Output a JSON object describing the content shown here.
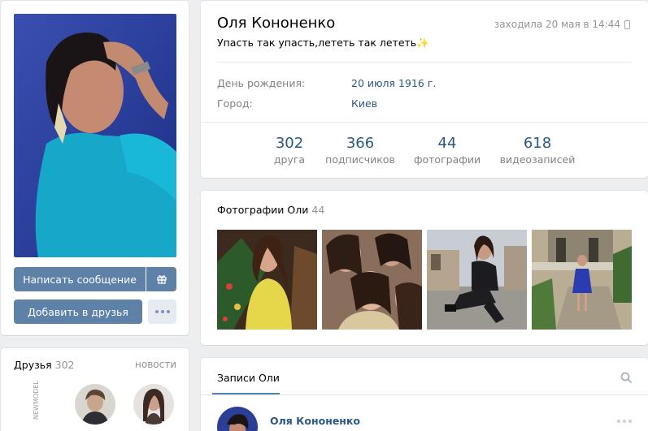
{
  "profile": {
    "name": "Оля Кононенко",
    "last_seen": "заходила 20 мая в 14:44",
    "status": "Упасть так упасть,лететь так лететь✨",
    "info": [
      {
        "label": "День рождения:",
        "value": "20 июля 1916 г."
      },
      {
        "label": "Город:",
        "value": "Киев"
      }
    ],
    "counters": [
      {
        "num": "302",
        "label": "друга"
      },
      {
        "num": "366",
        "label": "подписчиков"
      },
      {
        "num": "44",
        "label": "фотографии"
      },
      {
        "num": "618",
        "label": "видеозаписей"
      }
    ]
  },
  "actions": {
    "message": "Написать сообщение",
    "add_friend": "Добавить в друзья"
  },
  "friends": {
    "title": "Друзья",
    "count": "302",
    "news": "новости",
    "watermark": "NEWMODEL"
  },
  "photos": {
    "title": "Фотографии Оли",
    "count": "44"
  },
  "wall": {
    "tab": "Записи Оли",
    "post_author": "Оля Кононенко"
  },
  "colors": {
    "accent": "#5e81a8",
    "link": "#2a5885",
    "muted": "#828282",
    "background": "#edeef0"
  }
}
